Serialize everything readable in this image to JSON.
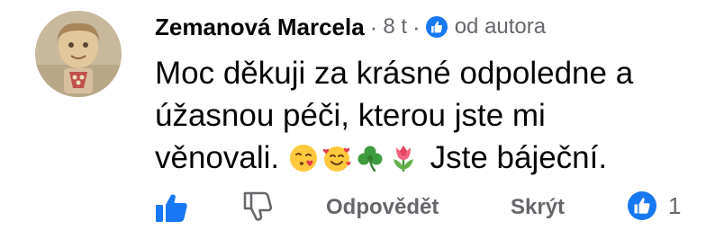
{
  "comment": {
    "author": "Zemanová Marcela",
    "time": "8 t",
    "separator": "·",
    "author_badge": "od autora",
    "text_before_emojis": "Moc děkuji za krásné odpoledne a úžasnou péči, kterou jste mi věnovali. ",
    "text_after_emojis": " Jste báječní.",
    "emojis": [
      "face-blowing-kiss-icon",
      "smiling-face-with-hearts-icon",
      "shamrock-icon",
      "tulip-icon"
    ]
  },
  "actions": {
    "reply_label": "Odpovědět",
    "hide_label": "Skrýt",
    "like_count": "1"
  },
  "colors": {
    "accent": "#1877f2",
    "secondary_text": "#65676b",
    "primary_text": "#050505"
  }
}
